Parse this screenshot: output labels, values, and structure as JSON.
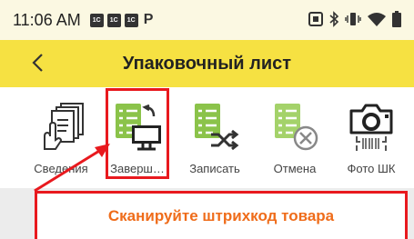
{
  "status_bar": {
    "time": "11:06 AM",
    "app_icons": [
      "1C",
      "1C",
      "1C"
    ],
    "p_label": "P",
    "right_icons": [
      "nfc-icon",
      "bluetooth-icon",
      "vibrate-icon",
      "wifi-icon",
      "battery-icon"
    ]
  },
  "header": {
    "title": "Упаковочный лист",
    "back_icon": "chevron-left-icon"
  },
  "toolbar": {
    "items": [
      {
        "label": "Сведения",
        "icon": "documents-hand-icon"
      },
      {
        "label": "Заверш…",
        "icon": "list-to-monitor-icon"
      },
      {
        "label": "Записать",
        "icon": "list-shuffle-icon"
      },
      {
        "label": "Отмена",
        "icon": "list-cancel-icon"
      },
      {
        "label": "Фото ШК",
        "icon": "camera-barcode-icon"
      }
    ]
  },
  "main": {
    "scan_prompt": "Сканируйте штрихкод товара"
  },
  "colors": {
    "appbar": "#f6e142",
    "highlight": "#e8191e",
    "prompt": "#ef6c1a",
    "icon_green": "#8bc34a"
  }
}
